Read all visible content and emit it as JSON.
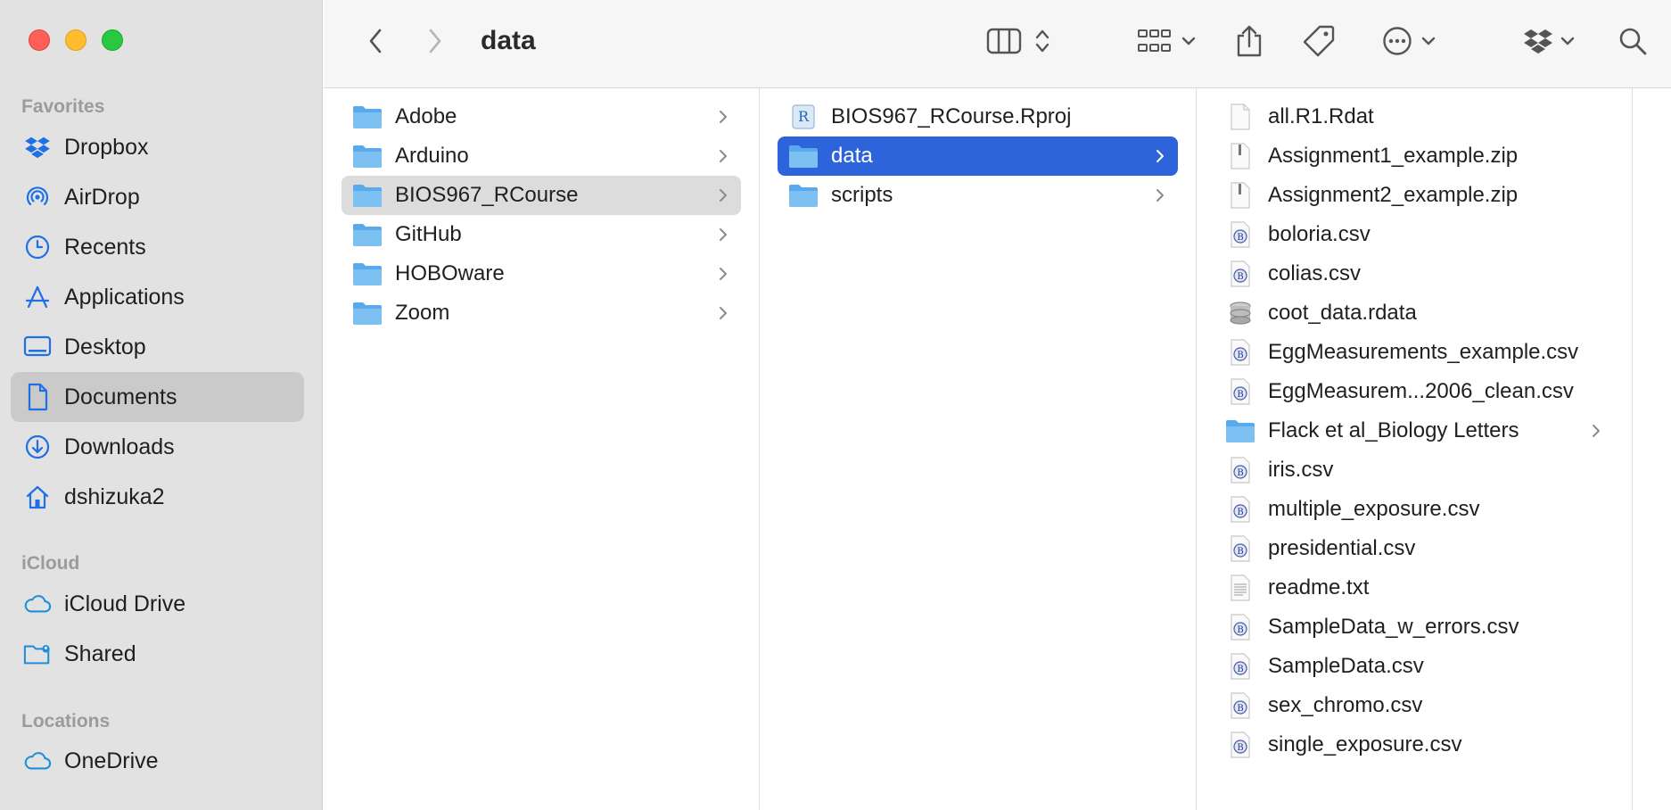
{
  "window": {
    "title": "data"
  },
  "sidebar": {
    "favorites_header": "Favorites",
    "icloud_header": "iCloud",
    "locations_header": "Locations",
    "favorites": [
      {
        "label": "Dropbox",
        "icon": "dropbox-icon"
      },
      {
        "label": "AirDrop",
        "icon": "airdrop-icon"
      },
      {
        "label": "Recents",
        "icon": "clock-icon"
      },
      {
        "label": "Applications",
        "icon": "applications-icon"
      },
      {
        "label": "Desktop",
        "icon": "desktop-icon"
      },
      {
        "label": "Documents",
        "icon": "document-icon",
        "selected": true
      },
      {
        "label": "Downloads",
        "icon": "download-icon"
      },
      {
        "label": "dshizuka2",
        "icon": "home-icon"
      }
    ],
    "icloud": [
      {
        "label": "iCloud Drive",
        "icon": "cloud-icon"
      },
      {
        "label": "Shared",
        "icon": "shared-folder-icon"
      }
    ],
    "locations": [
      {
        "label": "OneDrive",
        "icon": "cloud-icon"
      }
    ]
  },
  "columns": [
    {
      "items": [
        {
          "label": "Adobe",
          "type": "folder",
          "chevron": true
        },
        {
          "label": "Arduino",
          "type": "folder",
          "chevron": true
        },
        {
          "label": "BIOS967_RCourse",
          "type": "folder",
          "chevron": true,
          "selected": "gray"
        },
        {
          "label": "GitHub",
          "type": "folder",
          "chevron": true
        },
        {
          "label": "HOBOware",
          "type": "folder",
          "chevron": true
        },
        {
          "label": "Zoom",
          "type": "folder",
          "chevron": true
        }
      ]
    },
    {
      "items": [
        {
          "label": "BIOS967_RCourse.Rproj",
          "type": "rproj"
        },
        {
          "label": "data",
          "type": "folder",
          "chevron": true,
          "selected": "blue"
        },
        {
          "label": "scripts",
          "type": "folder",
          "chevron": true
        }
      ]
    },
    {
      "items": [
        {
          "label": "all.R1.Rdat",
          "type": "blank"
        },
        {
          "label": "Assignment1_example.zip",
          "type": "zip"
        },
        {
          "label": "Assignment2_example.zip",
          "type": "zip"
        },
        {
          "label": "boloria.csv",
          "type": "csv"
        },
        {
          "label": "colias.csv",
          "type": "csv"
        },
        {
          "label": "coot_data.rdata",
          "type": "rdata"
        },
        {
          "label": "EggMeasurements_example.csv",
          "type": "csv"
        },
        {
          "label": "EggMeasurem...2006_clean.csv",
          "type": "csv"
        },
        {
          "label": "Flack et al_Biology Letters",
          "type": "folder",
          "chevron": true
        },
        {
          "label": "iris.csv",
          "type": "csv"
        },
        {
          "label": "multiple_exposure.csv",
          "type": "csv"
        },
        {
          "label": "presidential.csv",
          "type": "csv"
        },
        {
          "label": "readme.txt",
          "type": "txt"
        },
        {
          "label": "SampleData_w_errors.csv",
          "type": "csv"
        },
        {
          "label": "SampleData.csv",
          "type": "csv"
        },
        {
          "label": "sex_chromo.csv",
          "type": "csv"
        },
        {
          "label": "single_exposure.csv",
          "type": "csv"
        }
      ]
    }
  ],
  "colors": {
    "accent": "#2d64db",
    "sidebar_icon": "#1f6fe5",
    "folder": "#6fb4ee"
  }
}
